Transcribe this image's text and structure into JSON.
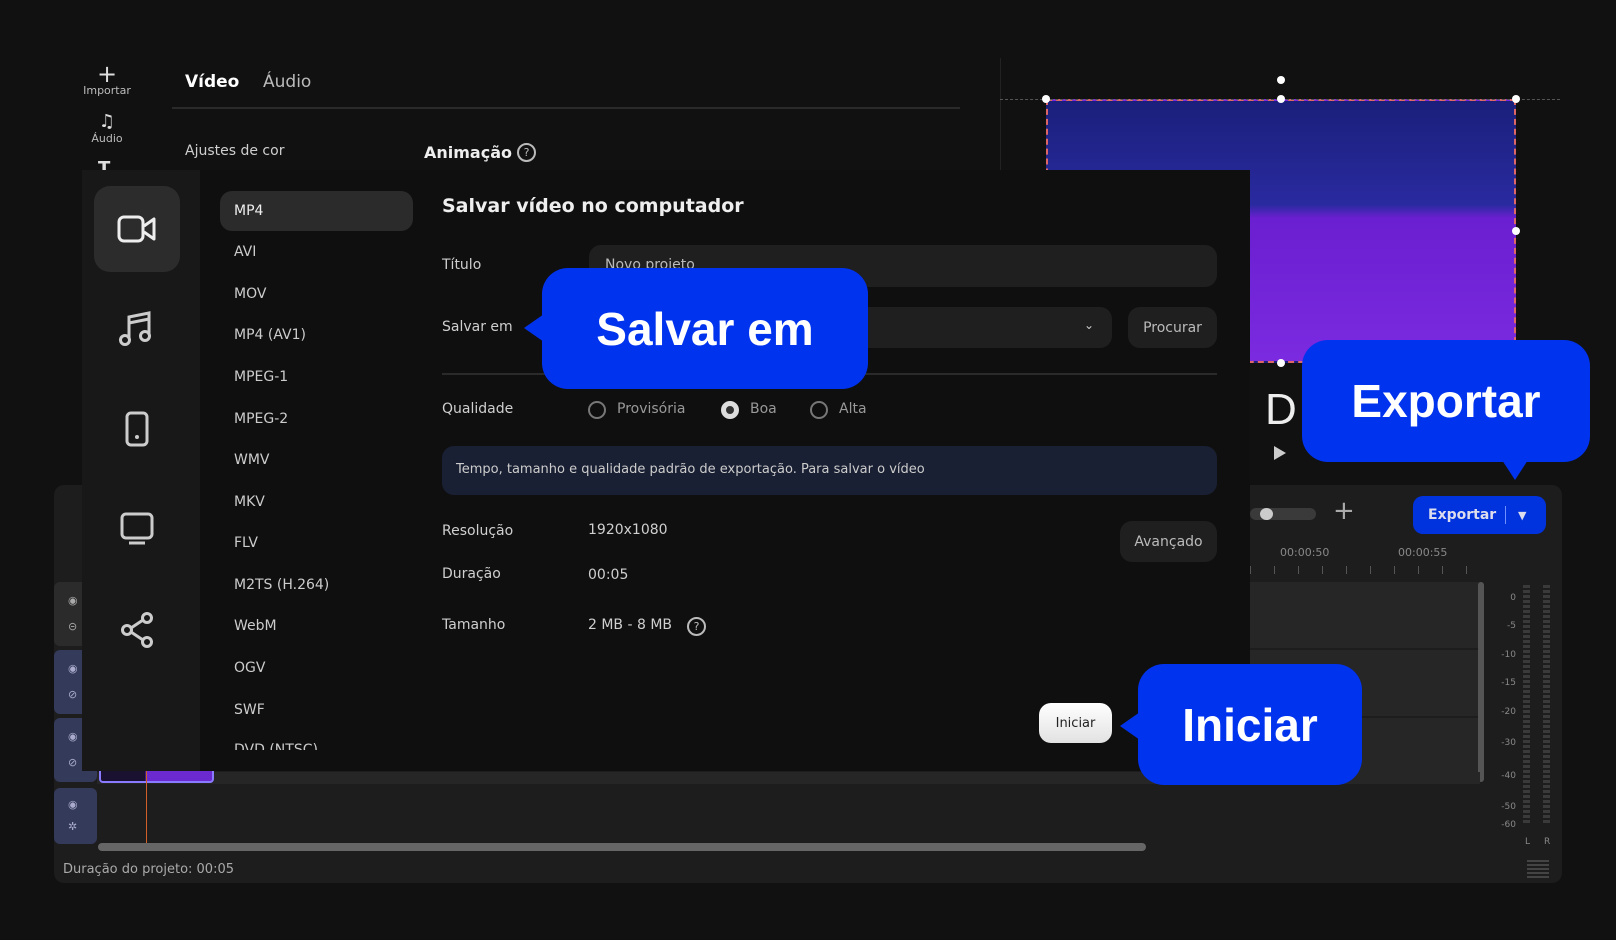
{
  "toolbar": {
    "import_label": "Importar",
    "audio_label": "Áudio"
  },
  "editor_tabs": {
    "video": "Vídeo",
    "audio": "Áudio"
  },
  "editor_panel": {
    "color_adjust": "Ajustes de cor",
    "animation": "Animação"
  },
  "dialog": {
    "title": "Salvar vídeo no computador",
    "formats": [
      "MP4",
      "AVI",
      "MOV",
      "MP4 (AV1)",
      "MPEG-1",
      "MPEG-2",
      "WMV",
      "MKV",
      "FLV",
      "M2TS (H.264)",
      "WebM",
      "OGV",
      "SWF",
      "DVD (NTSC)"
    ],
    "selected_format": "MP4",
    "title_label": "Título",
    "title_value": "Novo projeto",
    "save_in_label": "Salvar em",
    "browse_button": "Procurar",
    "quality_label": "Qualidade",
    "quality_options": [
      "Provisória",
      "Boa",
      "Alta"
    ],
    "quality_selected": "Boa",
    "info_text": "Tempo, tamanho e qualidade padrão de exportação. Para salvar o vídeo",
    "resolution_label": "Resolução",
    "resolution_value": "1920x1080",
    "advanced_button": "Avançado",
    "duration_label": "Duração",
    "duration_value": "00:05",
    "size_label": "Tamanho",
    "size_value": "2 MB - 8 MB",
    "start_button": "Iniciar"
  },
  "callouts": {
    "save_in": "Salvar em",
    "export": "Exportar",
    "start": "Iniciar"
  },
  "preview": {
    "overlay_letter": "D"
  },
  "timeline": {
    "export_button": "Exportar",
    "time_marks": [
      "00:00:50",
      "00:00:55"
    ],
    "meter_scale": [
      "0",
      "-5",
      "-10",
      "-15",
      "-20",
      "-30",
      "-40",
      "-50",
      "-60"
    ],
    "channels": [
      "L",
      "R"
    ],
    "project_duration": "Duração do projeto: 00:05"
  },
  "colors": {
    "accent": "#0033ee",
    "dialog_bg": "#0f0f0f",
    "info_bg": "#1a2033"
  }
}
